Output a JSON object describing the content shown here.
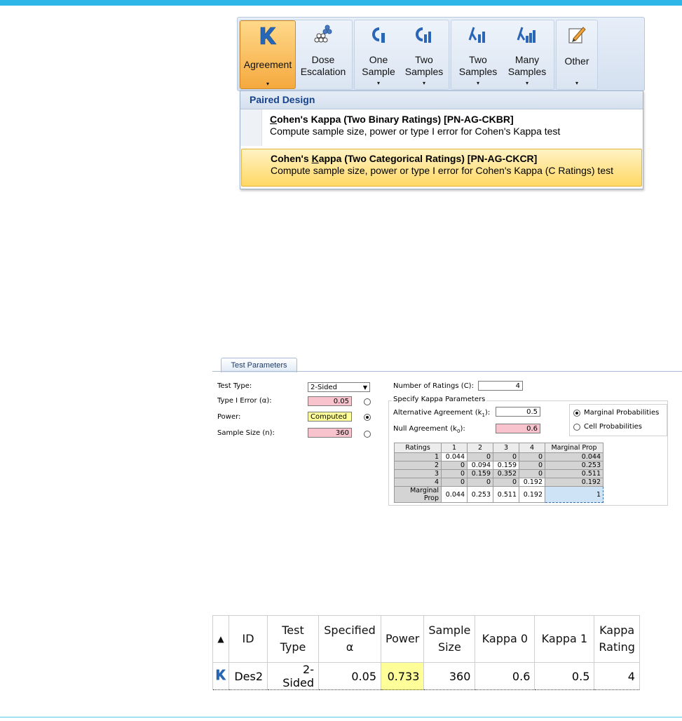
{
  "ribbon": {
    "buttons": [
      {
        "label1": "Agreement",
        "label2": "",
        "icon": "kappa-k-icon"
      },
      {
        "label1": "Dose",
        "label2": "Escalation",
        "icon": "dose-dots-icon"
      },
      {
        "label1": "One",
        "label2": "Sample",
        "icon": "c-bar-icon"
      },
      {
        "label1": "Two",
        "label2": "Samples",
        "icon": "c-bars-icon"
      },
      {
        "label1": "Two",
        "label2": "Samples",
        "icon": "lambda-bars-icon"
      },
      {
        "label1": "Many",
        "label2": "Samples",
        "icon": "lambda-bars-many-icon"
      },
      {
        "label1": "Other",
        "label2": "",
        "icon": "pencil-icon"
      }
    ],
    "dropdown_arrow": "▾"
  },
  "menu": {
    "header": "Paired Design",
    "items": [
      {
        "title_prefix": "C",
        "title_rest": "ohen's Kappa (Two Binary Ratings) [PN-AG-CKBR]",
        "desc": "Compute sample size, power or type I error for Cohen's Kappa test"
      },
      {
        "title_prefix": "Cohen's ",
        "title_ul": "K",
        "title_rest": "appa (Two Categorical Ratings) [PN-AG-CKCR]",
        "desc": "Compute sample size, power or type I error for Cohen's Kappa (C Ratings) test"
      }
    ]
  },
  "params": {
    "tab": "Test Parameters",
    "test_type_label": "Test Type:",
    "test_type_value": "2-Sided",
    "type1_label": "Type I Error (α):",
    "type1_value": "0.05",
    "power_label": "Power:",
    "power_value": "Computed",
    "n_label": "Sample Size (n):",
    "n_value": "360",
    "num_ratings_label": "Number of Ratings (C):",
    "num_ratings_value": "4",
    "group_title": "Specify Kappa Parameters",
    "alt_label": "Alternative Agreement (k",
    "alt_sub": "1",
    "alt_value": "0.5",
    "null_label": "Null Agreement (k",
    "null_sub": "0",
    "null_value": "0.6",
    "opt_marginal": "Marginal Probabilities",
    "opt_cell": "Cell Probabilities",
    "grid_headers": [
      "Ratings",
      "1",
      "2",
      "3",
      "4",
      "Marginal Prop"
    ],
    "grid_rows": [
      [
        "1",
        "0.044",
        "0",
        "0",
        "0",
        "0.044"
      ],
      [
        "2",
        "0",
        "0.094",
        "0.159",
        "0",
        "0.253"
      ],
      [
        "3",
        "0",
        "0.159",
        "0.352",
        "0",
        "0.511"
      ],
      [
        "4",
        "0",
        "0",
        "0",
        "0.192",
        "0.192"
      ],
      [
        "Marginal Prop",
        "0.044",
        "0.253",
        "0.511",
        "0.192",
        "1"
      ]
    ]
  },
  "results": {
    "headers": [
      "▲",
      "ID",
      "Test\nType",
      "Specified\nα",
      "Power",
      "Sample\nSize",
      "Kappa 0",
      "Kappa 1",
      "Kappa\nRating"
    ],
    "row": [
      "K",
      "Des2",
      "2-Sided",
      "0.05",
      "0.733",
      "360",
      "0.6",
      "0.5",
      "4"
    ]
  },
  "colors": {
    "accent": "#2fb6e9",
    "active_button": "#f5a93e",
    "pink_input": "#f9c3cd",
    "computed_yellow": "#ffff99",
    "menu_header_text": "#15428b"
  }
}
